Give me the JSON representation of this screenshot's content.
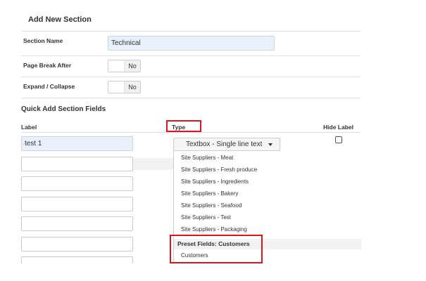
{
  "form": {
    "title": "Add New Section",
    "section_name": {
      "label": "Section Name",
      "value": "Technical"
    },
    "page_break_after": {
      "label": "Page Break After",
      "value": "No"
    },
    "expand_collapse": {
      "label": "Expand / Collapse",
      "value": "No"
    }
  },
  "quick_add": {
    "title": "Quick Add Section Fields",
    "columns": {
      "label": "Label",
      "type": "Type",
      "hide_label": "Hide Label"
    },
    "first_row": {
      "label_value": "test 1",
      "type_value": "Textbox - Single line text",
      "hide_label_checked": false
    }
  },
  "type_dropdown": {
    "items": [
      "Site Suppliers - Meat",
      "Site Suppliers - Fresh produce",
      "Site Suppliers - Ingredients",
      "Site Suppliers - Bakery",
      "Site Suppliers - Seafood",
      "Site Suppliers - Test",
      "Site Suppliers - Packaging"
    ],
    "group_label": "Preset Fields: Customers",
    "group_items": [
      "Customers"
    ]
  },
  "colors": {
    "highlight": "#e0141e",
    "input_fill": "#e8f0fb"
  }
}
